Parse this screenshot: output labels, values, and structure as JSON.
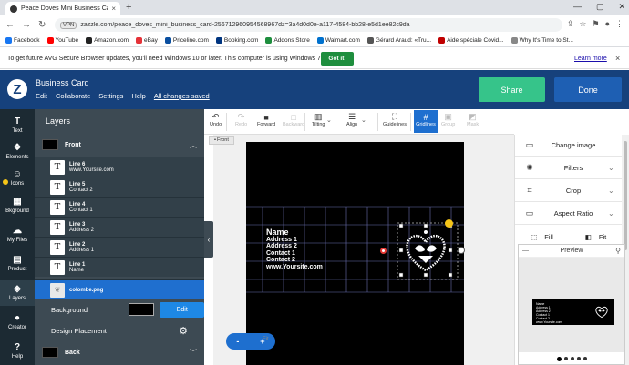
{
  "browser": {
    "tab_title": "Peace Doves Mini Business Card",
    "tab_close": "×",
    "new_tab": "+",
    "vpn_badge": "VPN",
    "url": "zazzle.com/peace_doves_mini_business_card-256712960954568967dz=3a4d0d0e-a117-4584-bb28-e5d1ee82c9da",
    "bookmarks": [
      {
        "label": "Facebook",
        "color": "#1877f2"
      },
      {
        "label": "YouTube",
        "color": "#ff0000"
      },
      {
        "label": "Amazon.com",
        "color": "#222222"
      },
      {
        "label": "eBay",
        "color": "#e53238"
      },
      {
        "label": "Priceline.com",
        "color": "#0a4fa0"
      },
      {
        "label": "Booking.com",
        "color": "#003580"
      },
      {
        "label": "Addons Store",
        "color": "#1e8e3e"
      },
      {
        "label": "Walmart.com",
        "color": "#0071ce"
      },
      {
        "label": "Gérard Araud: «Tru...",
        "color": "#555555"
      },
      {
        "label": "Aide spéciale Covid...",
        "color": "#c00000"
      },
      {
        "label": "Why It's Time to St...",
        "color": "#888888"
      }
    ]
  },
  "notice": {
    "text": "To get future AVG Secure Browser updates, you'll need Windows 10 or later. This computer is using Windows 7.",
    "button": "Got it!",
    "link": "Learn more",
    "close": "×"
  },
  "header": {
    "logo": "Z",
    "title": "Business Card",
    "menu": [
      "Edit",
      "Collaborate",
      "Settings",
      "Help"
    ],
    "saved": "All changes saved",
    "share": "Share",
    "done": "Done",
    "accent_share": "#36c48a",
    "accent_done": "#1e5fb3"
  },
  "rail": [
    {
      "label": "Text",
      "glyph": "T"
    },
    {
      "label": "Elements",
      "glyph": "❖"
    },
    {
      "label": "Icons",
      "glyph": "☺"
    },
    {
      "label": "Bkground",
      "glyph": "▦"
    },
    {
      "label": "My Files",
      "glyph": "☁"
    },
    {
      "label": "Product",
      "glyph": "▤"
    },
    {
      "label": "Layers",
      "glyph": "◈"
    },
    {
      "label": "Creator",
      "glyph": "●"
    },
    {
      "label": "Help",
      "glyph": "?"
    }
  ],
  "layers": {
    "title": "Layers",
    "front": "Front",
    "back": "Back",
    "rows": [
      {
        "name": "Line 6",
        "value": "www.Yoursite.com"
      },
      {
        "name": "Line 5",
        "value": "Contact 2"
      },
      {
        "name": "Line 4",
        "value": "Contact 1"
      },
      {
        "name": "Line 3",
        "value": "Address 2"
      },
      {
        "name": "Line 2",
        "value": "Address 1"
      },
      {
        "name": "Line 1",
        "value": "Name"
      }
    ],
    "image_layer": "colombe.png",
    "background_label": "Background",
    "edit_label": "Edit",
    "design_placement": "Design Placement"
  },
  "toolbar": [
    {
      "label": "Undo",
      "glyph": "↶",
      "state": "normal"
    },
    {
      "label": "Redo",
      "glyph": "↷",
      "state": "disabled"
    },
    {
      "label": "Forward",
      "glyph": "■",
      "state": "normal"
    },
    {
      "label": "Backward",
      "glyph": "□",
      "state": "disabled"
    },
    {
      "label": "Tilting",
      "glyph": "▥",
      "state": "normal"
    },
    {
      "label": "Align",
      "glyph": "☰",
      "state": "normal"
    },
    {
      "label": "Guidelines",
      "glyph": "⛶",
      "state": "normal"
    },
    {
      "label": "Gridlines",
      "glyph": "#",
      "state": "active"
    },
    {
      "label": "Group",
      "glyph": "▣",
      "state": "disabled"
    },
    {
      "label": "Mask",
      "glyph": "◩",
      "state": "disabled"
    }
  ],
  "front_chip": "Front",
  "card": {
    "name": "Name",
    "lines": [
      "Address 1",
      "Address 2",
      "Contact 1",
      "Contact 2",
      "www.Yoursite.com"
    ]
  },
  "zoom": {
    "minus": "-",
    "plus": "+",
    "fit": "Fit"
  },
  "right_panel": [
    {
      "label": "Change image",
      "glyph": "▭",
      "chevron": ""
    },
    {
      "label": "Filters",
      "glyph": "✺",
      "chevron": "⌄"
    },
    {
      "label": "Crop",
      "glyph": "⌗",
      "chevron": "⌄"
    },
    {
      "label": "Aspect Ratio",
      "glyph": "▭",
      "chevron": "⌄"
    }
  ],
  "fill_label": "Fill",
  "fit_label": "Fit",
  "preview": {
    "title": "Preview",
    "mini_lines": [
      "Name",
      "Address 1",
      "Address 2",
      "Contact 1",
      "Contact 2",
      "www.Yoursite.com"
    ]
  }
}
